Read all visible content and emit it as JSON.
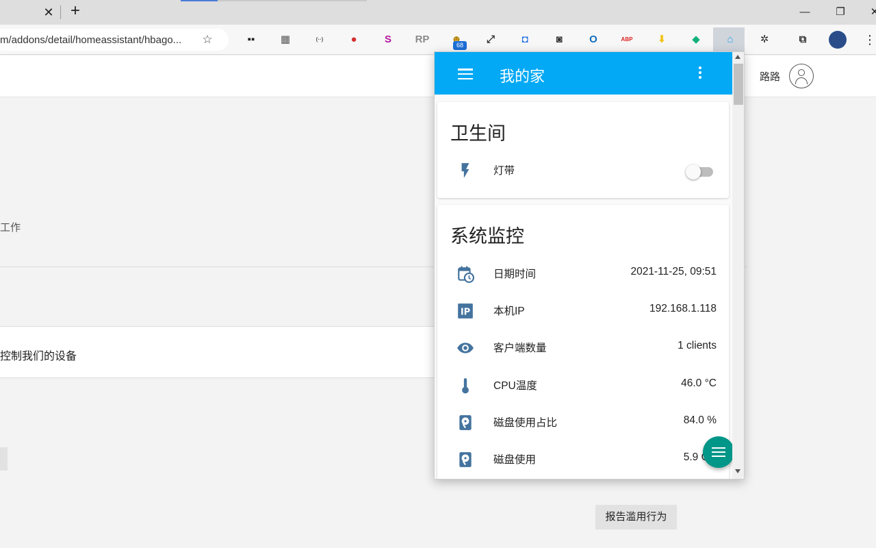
{
  "browser": {
    "tab_close_glyph": "✕",
    "new_tab_glyph": "+",
    "url": "m/addons/detail/homeassistant/hbago...",
    "extension_badge": "68",
    "window_controls": {
      "minimize": "—",
      "restore": "❐",
      "close": "✕"
    },
    "more_glyph": "⋮",
    "extensions": [
      {
        "name": "tab-manager-extension",
        "label": "▪▪",
        "color": "#222222"
      },
      {
        "name": "qr-code-extension",
        "label": "▦",
        "color": "#555555"
      },
      {
        "name": "dot-dash-extension",
        "label": "(··)",
        "color": "#555555"
      },
      {
        "name": "record-extension",
        "label": "●",
        "color": "#d32f2f"
      },
      {
        "name": "s-extension",
        "label": "S",
        "color": "#b5179e"
      },
      {
        "name": "rp-extension",
        "label": "RP",
        "color": "#8a8a8a"
      },
      {
        "name": "avatar-extension",
        "label": "☻",
        "color": "#b8860b"
      },
      {
        "name": "expand-extension",
        "label": "⤢",
        "color": "#333333"
      },
      {
        "name": "capture-extension",
        "label": "◘",
        "color": "#1e6fe0"
      },
      {
        "name": "screenshot-extension",
        "label": "◙",
        "color": "#333333"
      },
      {
        "name": "outlook-extension",
        "label": "O",
        "color": "#0f6cbd"
      },
      {
        "name": "adblock-extension",
        "label": "ABP",
        "color": "#e02020"
      },
      {
        "name": "download-extension",
        "label": "⬇",
        "color": "#f0c419"
      },
      {
        "name": "green-extension",
        "label": "◆",
        "color": "#13b07a"
      },
      {
        "name": "home-assistant-extension",
        "label": "⌂",
        "color": "#29a3e8"
      },
      {
        "name": "puzzle-extension",
        "label": "✲",
        "color": "#333333"
      },
      {
        "name": "collections-extension",
        "label": "⧉",
        "color": "#333333"
      }
    ]
  },
  "page": {
    "user_name": "路路",
    "text_fragment_1": "工作",
    "text_fragment_2": "控制我们的设备",
    "report_button": "报告滥用行为"
  },
  "ha": {
    "title": "我的家",
    "accent_color": "#03a9f4",
    "fab_color": "#009688",
    "cards": [
      {
        "title": "卫生间",
        "entities": [
          {
            "icon": "lightning-icon",
            "label": "灯带",
            "state": "off"
          }
        ]
      },
      {
        "title": "系统监控",
        "entities": [
          {
            "icon": "calendar-clock-icon",
            "label": "日期时间",
            "value": "2021-11-25, 09:51"
          },
          {
            "icon": "ip-icon",
            "label": "本机IP",
            "value": "192.168.1.118",
            "icon_text": "IP"
          },
          {
            "icon": "eye-icon",
            "label": "客户端数量",
            "value": "1 clients"
          },
          {
            "icon": "thermometer-icon",
            "label": "CPU温度",
            "value": "46.0 °C"
          },
          {
            "icon": "harddisk-icon",
            "label": "磁盘使用占比",
            "value": "84.0 %"
          },
          {
            "icon": "harddisk-icon",
            "label": "磁盘使用",
            "value": "5.9 GB"
          }
        ]
      }
    ]
  }
}
